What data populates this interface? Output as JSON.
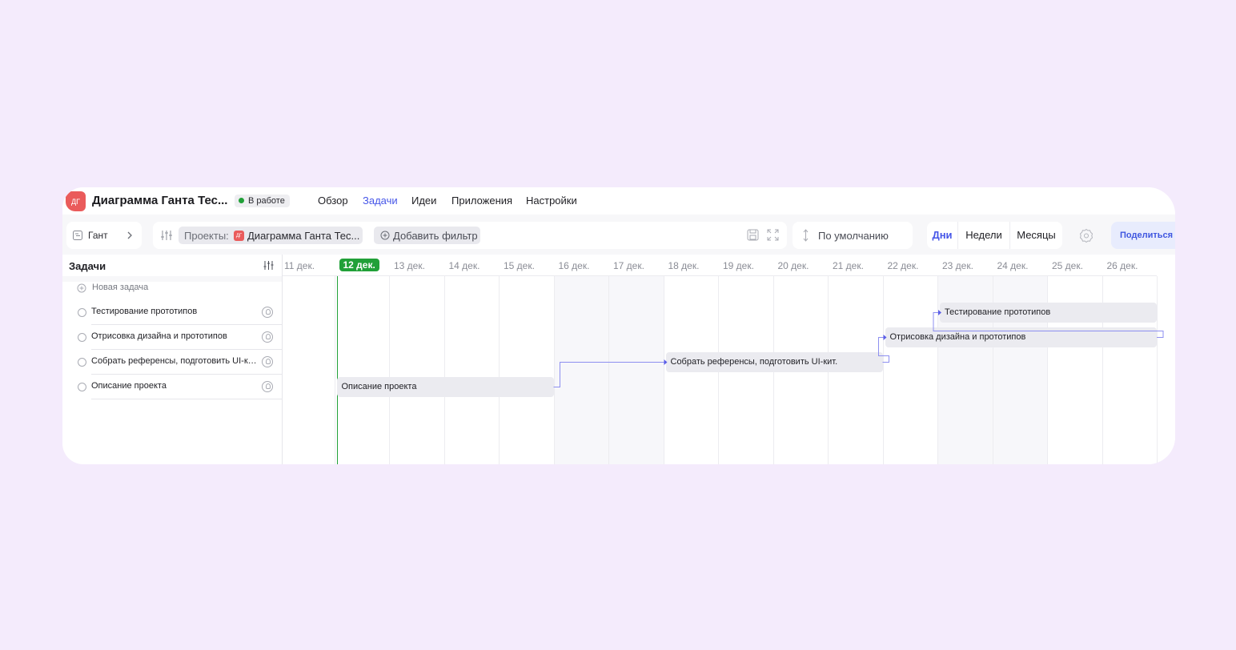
{
  "header": {
    "project_icon": "ДГ",
    "project_title": "Диаграмма Ганта Тес...",
    "status": "В работе",
    "nav": [
      {
        "label": "Обзор",
        "active": false
      },
      {
        "label": "Задачи",
        "active": true
      },
      {
        "label": "Идеи",
        "active": false
      },
      {
        "label": "Приложения",
        "active": false
      },
      {
        "label": "Настройки",
        "active": false
      }
    ]
  },
  "toolbar": {
    "view_label": "Гант",
    "filter_label": "Проекты:",
    "filter_project_icon": "ДГ",
    "filter_project": "Диаграмма Ганта Тес...",
    "add_filter": "Добавить фильтр",
    "sort_label": "По умолчанию",
    "scale": [
      {
        "label": "Дни",
        "active": true
      },
      {
        "label": "Недели",
        "active": false
      },
      {
        "label": "Месяцы",
        "active": false
      }
    ],
    "share_label": "Поделиться"
  },
  "tasks_panel": {
    "title": "Задачи",
    "new_task": "Новая задача",
    "tasks": [
      "Тестирование прототипов",
      "Отрисовка дизайна и прототипов",
      "Собрать референсы, подготовить UI-кит.",
      "Описание проекта"
    ]
  },
  "timeline": {
    "dates": [
      "11 дек.",
      "12 дек.",
      "13 дек.",
      "14 дек.",
      "15 дек.",
      "16 дек.",
      "17 дек.",
      "18 дек.",
      "19 дек.",
      "20 дек.",
      "21 дек.",
      "22 дек.",
      "23 дек.",
      "24 дек.",
      "25 дек.",
      "26 дек."
    ],
    "today": "12 дек.",
    "weekend_dates": [
      "16 дек.",
      "17 дек.",
      "23 дек.",
      "24 дек."
    ],
    "bars": [
      {
        "label": "Тестирование прототипов",
        "start": "23 дек.",
        "end": "26 дек."
      },
      {
        "label": "Отрисовка дизайна и прототипов",
        "start": "22 дек.",
        "end": "26 дек."
      },
      {
        "label": "Собрать референсы, подготовить UI-кит.",
        "start": "18 дек.",
        "end": "21 дек."
      },
      {
        "label": "Описание проекта",
        "start": "12 дек.",
        "end": "15 дек."
      }
    ]
  },
  "colors": {
    "accent": "#4656e8",
    "today": "#21a038",
    "project_icon": "#ea5b5b",
    "background": "#f4ebfc"
  }
}
